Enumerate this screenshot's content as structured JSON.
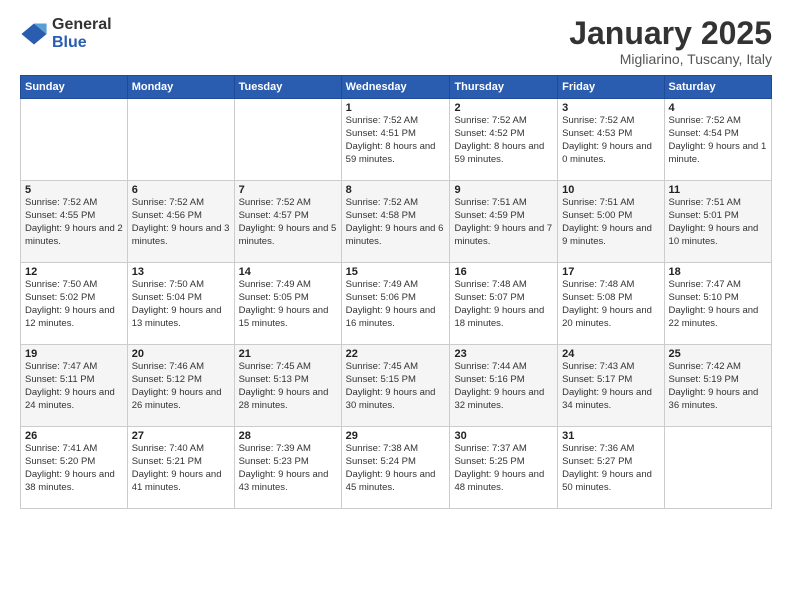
{
  "logo": {
    "general": "General",
    "blue": "Blue"
  },
  "header": {
    "month": "January 2025",
    "location": "Migliarino, Tuscany, Italy"
  },
  "days_of_week": [
    "Sunday",
    "Monday",
    "Tuesday",
    "Wednesday",
    "Thursday",
    "Friday",
    "Saturday"
  ],
  "weeks": [
    [
      {
        "day": "",
        "info": ""
      },
      {
        "day": "",
        "info": ""
      },
      {
        "day": "",
        "info": ""
      },
      {
        "day": "1",
        "info": "Sunrise: 7:52 AM\nSunset: 4:51 PM\nDaylight: 8 hours and 59 minutes."
      },
      {
        "day": "2",
        "info": "Sunrise: 7:52 AM\nSunset: 4:52 PM\nDaylight: 8 hours and 59 minutes."
      },
      {
        "day": "3",
        "info": "Sunrise: 7:52 AM\nSunset: 4:53 PM\nDaylight: 9 hours and 0 minutes."
      },
      {
        "day": "4",
        "info": "Sunrise: 7:52 AM\nSunset: 4:54 PM\nDaylight: 9 hours and 1 minute."
      }
    ],
    [
      {
        "day": "5",
        "info": "Sunrise: 7:52 AM\nSunset: 4:55 PM\nDaylight: 9 hours and 2 minutes."
      },
      {
        "day": "6",
        "info": "Sunrise: 7:52 AM\nSunset: 4:56 PM\nDaylight: 9 hours and 3 minutes."
      },
      {
        "day": "7",
        "info": "Sunrise: 7:52 AM\nSunset: 4:57 PM\nDaylight: 9 hours and 5 minutes."
      },
      {
        "day": "8",
        "info": "Sunrise: 7:52 AM\nSunset: 4:58 PM\nDaylight: 9 hours and 6 minutes."
      },
      {
        "day": "9",
        "info": "Sunrise: 7:51 AM\nSunset: 4:59 PM\nDaylight: 9 hours and 7 minutes."
      },
      {
        "day": "10",
        "info": "Sunrise: 7:51 AM\nSunset: 5:00 PM\nDaylight: 9 hours and 9 minutes."
      },
      {
        "day": "11",
        "info": "Sunrise: 7:51 AM\nSunset: 5:01 PM\nDaylight: 9 hours and 10 minutes."
      }
    ],
    [
      {
        "day": "12",
        "info": "Sunrise: 7:50 AM\nSunset: 5:02 PM\nDaylight: 9 hours and 12 minutes."
      },
      {
        "day": "13",
        "info": "Sunrise: 7:50 AM\nSunset: 5:04 PM\nDaylight: 9 hours and 13 minutes."
      },
      {
        "day": "14",
        "info": "Sunrise: 7:49 AM\nSunset: 5:05 PM\nDaylight: 9 hours and 15 minutes."
      },
      {
        "day": "15",
        "info": "Sunrise: 7:49 AM\nSunset: 5:06 PM\nDaylight: 9 hours and 16 minutes."
      },
      {
        "day": "16",
        "info": "Sunrise: 7:48 AM\nSunset: 5:07 PM\nDaylight: 9 hours and 18 minutes."
      },
      {
        "day": "17",
        "info": "Sunrise: 7:48 AM\nSunset: 5:08 PM\nDaylight: 9 hours and 20 minutes."
      },
      {
        "day": "18",
        "info": "Sunrise: 7:47 AM\nSunset: 5:10 PM\nDaylight: 9 hours and 22 minutes."
      }
    ],
    [
      {
        "day": "19",
        "info": "Sunrise: 7:47 AM\nSunset: 5:11 PM\nDaylight: 9 hours and 24 minutes."
      },
      {
        "day": "20",
        "info": "Sunrise: 7:46 AM\nSunset: 5:12 PM\nDaylight: 9 hours and 26 minutes."
      },
      {
        "day": "21",
        "info": "Sunrise: 7:45 AM\nSunset: 5:13 PM\nDaylight: 9 hours and 28 minutes."
      },
      {
        "day": "22",
        "info": "Sunrise: 7:45 AM\nSunset: 5:15 PM\nDaylight: 9 hours and 30 minutes."
      },
      {
        "day": "23",
        "info": "Sunrise: 7:44 AM\nSunset: 5:16 PM\nDaylight: 9 hours and 32 minutes."
      },
      {
        "day": "24",
        "info": "Sunrise: 7:43 AM\nSunset: 5:17 PM\nDaylight: 9 hours and 34 minutes."
      },
      {
        "day": "25",
        "info": "Sunrise: 7:42 AM\nSunset: 5:19 PM\nDaylight: 9 hours and 36 minutes."
      }
    ],
    [
      {
        "day": "26",
        "info": "Sunrise: 7:41 AM\nSunset: 5:20 PM\nDaylight: 9 hours and 38 minutes."
      },
      {
        "day": "27",
        "info": "Sunrise: 7:40 AM\nSunset: 5:21 PM\nDaylight: 9 hours and 41 minutes."
      },
      {
        "day": "28",
        "info": "Sunrise: 7:39 AM\nSunset: 5:23 PM\nDaylight: 9 hours and 43 minutes."
      },
      {
        "day": "29",
        "info": "Sunrise: 7:38 AM\nSunset: 5:24 PM\nDaylight: 9 hours and 45 minutes."
      },
      {
        "day": "30",
        "info": "Sunrise: 7:37 AM\nSunset: 5:25 PM\nDaylight: 9 hours and 48 minutes."
      },
      {
        "day": "31",
        "info": "Sunrise: 7:36 AM\nSunset: 5:27 PM\nDaylight: 9 hours and 50 minutes."
      },
      {
        "day": "",
        "info": ""
      }
    ]
  ]
}
